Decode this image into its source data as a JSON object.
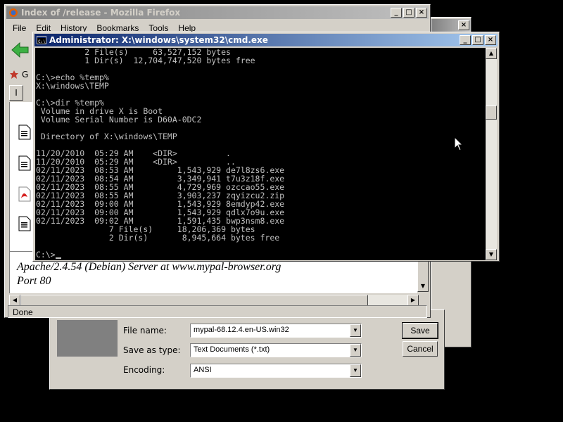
{
  "save_dialog": {
    "file_name_label": "File name:",
    "file_name_value": "mypal-68.12.4.en-US.win32",
    "save_as_type_label": "Save as type:",
    "save_as_type_value": "Text Documents (*.txt)",
    "encoding_label": "Encoding:",
    "encoding_value": "ANSI",
    "save_button": "Save",
    "cancel_button": "Cancel"
  },
  "firefox": {
    "title": "Index of /release - Mozilla Firefox",
    "menu": [
      "File",
      "Edit",
      "History",
      "Bookmarks",
      "Tools",
      "Help"
    ],
    "bookmark_partial": "G",
    "tab_partial": "I",
    "footer_server": "Apache/2.4.54 (Debian) Server at www.mypal-browser.org",
    "footer_port": "Port 80",
    "status": "Done",
    "icons": [
      "back-arrow-icon",
      "bookmark-icon",
      "file-icon",
      "pdf-icon"
    ]
  },
  "cmd": {
    "title": "Administrator: X:\\windows\\system32\\cmd.exe",
    "lines": [
      "          2 File(s)     63,527,152 bytes",
      "          1 Dir(s)  12,704,747,520 bytes free",
      "",
      "C:\\>echo %temp%",
      "X:\\windows\\TEMP",
      "",
      "C:\\>dir %temp%",
      " Volume in drive X is Boot",
      " Volume Serial Number is D60A-0DC2",
      "",
      " Directory of X:\\windows\\TEMP",
      "",
      "11/20/2010  05:29 AM    <DIR>          .",
      "11/20/2010  05:29 AM    <DIR>          ..",
      "02/11/2023  08:53 AM         1,543,929 de7l8zs6.exe",
      "02/11/2023  08:54 AM         3,349,941 t7u3z18f.exe",
      "02/11/2023  08:55 AM         4,729,969 ozccao55.exe",
      "02/11/2023  08:55 AM         3,903,237 zqyizcu2.zip",
      "02/11/2023  09:00 AM         1,543,929 8emdyp42.exe",
      "02/11/2023  09:00 AM         1,543,929 qdlx7o9u.exe",
      "02/11/2023  09:02 AM         1,591,435 bwp3nsm8.exe",
      "               7 File(s)     18,206,369 bytes",
      "               2 Dir(s)       8,945,664 bytes free",
      "",
      "C:\\>"
    ]
  },
  "colors": {
    "desktop": "#000000",
    "active_title": "#0a246a",
    "inactive_title": "#808080",
    "console_text": "#c0c0c0"
  }
}
